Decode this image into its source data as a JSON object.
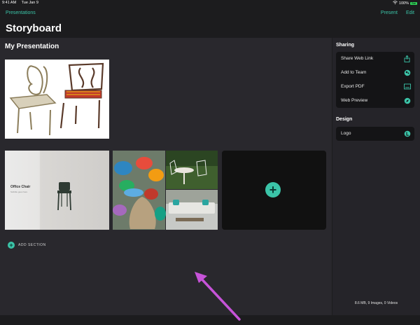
{
  "status_bar": {
    "time": "9:41 AM",
    "date": "Tue Jan 9",
    "battery": "100%",
    "battery_badge": "Bat"
  },
  "nav": {
    "back_label": "Presentations",
    "present_label": "Present",
    "edit_label": "Edit"
  },
  "page_title": "Storyboard",
  "main": {
    "section_title": "My Presentation",
    "office_tile": {
      "title": "Office Chair",
      "subtitle": "Subtitle goes here"
    },
    "add_section_label": "ADD SECTION"
  },
  "sidebar": {
    "sharing_header": "Sharing",
    "sharing_items": [
      {
        "label": "Share Web Link",
        "icon": "share-icon"
      },
      {
        "label": "Add to Team",
        "icon": "team-icon"
      },
      {
        "label": "Export PDF",
        "icon": "pdf-icon"
      },
      {
        "label": "Web Preview",
        "icon": "compass-icon"
      }
    ],
    "design_header": "Design",
    "design_items": [
      {
        "label": "Logo",
        "icon": "logo-icon"
      }
    ],
    "footer": "8.6 MB, 9 Images, 0 Videos"
  },
  "colors": {
    "accent": "#3bc4a8",
    "annotation_arrow": "#c653d8",
    "background": "#1c1c1e"
  }
}
